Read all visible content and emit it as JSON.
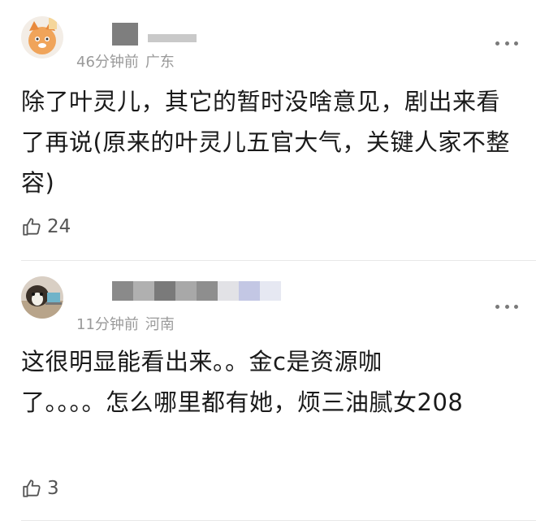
{
  "comments": [
    {
      "time": "46分钟前",
      "location": "广东",
      "text": "除了叶灵儿，其它的暂时没啥意见，剧出来看了再说(原来的叶灵儿五官大气，关键人家不整容)",
      "likes": "24"
    },
    {
      "time": "11分钟前",
      "location": "河南",
      "text": "这很明显能看出来。。金c是资源咖了。。。。怎么哪里都有她，烦三油腻女208",
      "likes": "3"
    }
  ],
  "icons": {
    "more": "more-dots-icon",
    "like": "thumbs-up-icon"
  },
  "colors": {
    "meta": "#9a9a9a",
    "text": "#1a1a1a"
  }
}
